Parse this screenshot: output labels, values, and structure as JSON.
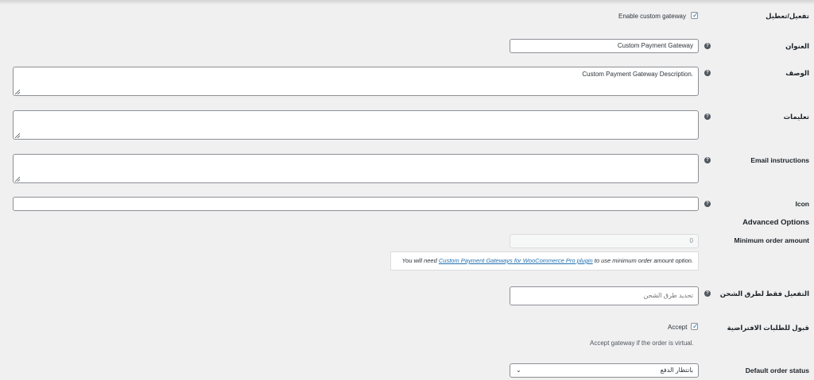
{
  "enable": {
    "label": "تفعيل/تعطيل",
    "checkbox_label": "Enable custom gateway",
    "checked": true
  },
  "title": {
    "label": "العنوان",
    "value": "Custom Payment Gateway"
  },
  "description": {
    "label": "الوصف",
    "value": "Custom Payment Gateway Description."
  },
  "instructions": {
    "label": "تعليمات",
    "value": ""
  },
  "email_instructions": {
    "label": "Email instructions",
    "value": ""
  },
  "icon": {
    "label": "Icon",
    "value": ""
  },
  "advanced": {
    "title": "Advanced Options"
  },
  "min_order": {
    "label": "Minimum order amount",
    "value": "0",
    "notice_prefix": "You will need ",
    "notice_link": "Custom Payment Gateways for WooCommerce Pro plugin",
    "notice_suffix": " to use minimum order amount option."
  },
  "shipping": {
    "label": "التفعيل فقط لطرق الشحن",
    "placeholder": "تحديد طرق الشحن"
  },
  "virtual": {
    "label": "قبول للطلبات الافتراضية",
    "checkbox_label": "Accept",
    "checked": true,
    "description": "Accept gateway if the order is virtual."
  },
  "order_status": {
    "label": "Default order status",
    "selected": "بانتظار الدفع"
  },
  "icons": {
    "help": "help-icon",
    "check": "check-icon",
    "resize": "resize-grip-icon",
    "chevron": "chevron-down-icon"
  },
  "colors": {
    "background": "#f0f0f1",
    "accent": "#2271b1",
    "border": "#8c8f94"
  }
}
